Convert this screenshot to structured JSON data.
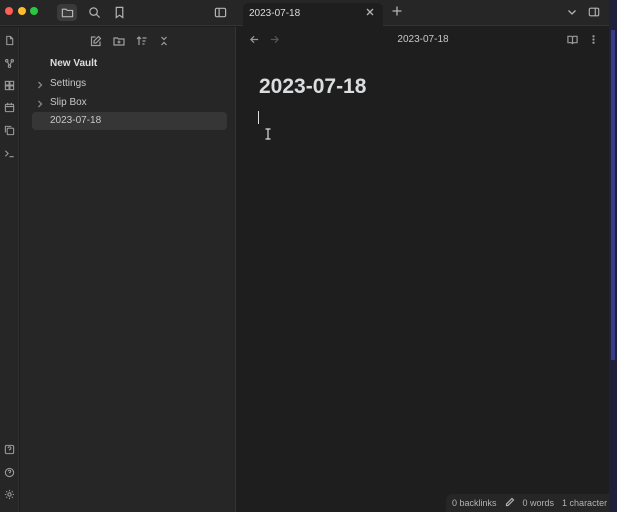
{
  "titlebar": {
    "left_buttons": [
      "folder-icon",
      "search-icon",
      "bookmark-icon",
      "sidebar-toggle-icon"
    ],
    "tab": {
      "title": "2023-07-18"
    },
    "right_buttons": [
      "chevron-down-icon",
      "right-sidebar-toggle-icon"
    ]
  },
  "ribbon": {
    "icons": [
      "files-icon",
      "graph-icon",
      "canvas-icon",
      "calendar-icon",
      "copy-icon",
      "terminal-icon",
      "help-vault-icon",
      "help-icon",
      "settings-icon"
    ]
  },
  "sidebar": {
    "vault_name": "New Vault",
    "items": [
      {
        "label": "Settings",
        "type": "folder"
      },
      {
        "label": "Slip Box",
        "type": "folder"
      },
      {
        "label": "2023-07-18",
        "type": "file",
        "active": true
      }
    ]
  },
  "main": {
    "header_title": "2023-07-18",
    "note_title": "2023-07-18"
  },
  "statusbar": {
    "backlinks": "0 backlinks",
    "words": "0 words",
    "characters": "1 character"
  }
}
